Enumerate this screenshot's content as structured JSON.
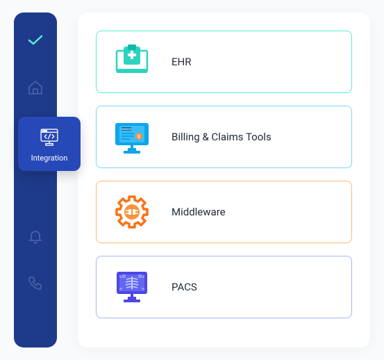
{
  "sidebar": {
    "active_label": "Integration"
  },
  "cards": {
    "ehr": {
      "label": "EHR"
    },
    "billing": {
      "label": "Billing & Claims Tools"
    },
    "middleware": {
      "label": "Middleware"
    },
    "pacs": {
      "label": "PACS"
    }
  },
  "colors": {
    "sidebar_bg": "#1e3a8a",
    "active_bg": "#2749b8",
    "ehr": "#2dd4bf",
    "billing": "#0ea5e9",
    "middleware": "#f97316",
    "pacs": "#4f46e5"
  }
}
